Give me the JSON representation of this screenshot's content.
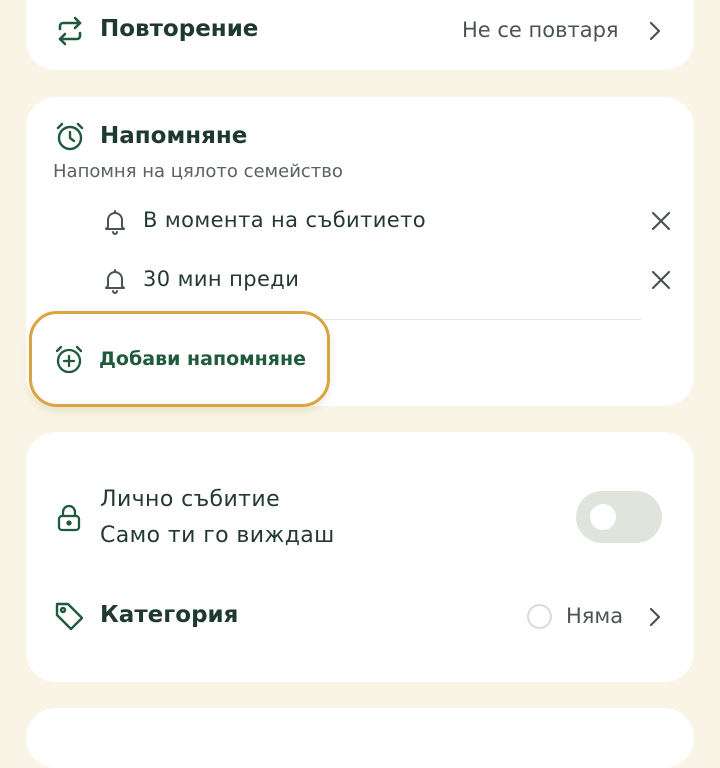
{
  "repeat": {
    "label": "Повторение",
    "value": "Не се повтаря",
    "icon": "repeat-icon"
  },
  "reminder": {
    "title": "Напомняне",
    "subtitle": "Напомня на цялото семейство",
    "icon": "alarm-clock-icon",
    "items": [
      {
        "label": "В момента на събитието",
        "icon": "bell-icon"
      },
      {
        "label": "30 мин преди",
        "icon": "bell-icon"
      }
    ],
    "add_label": "Добави напомняне"
  },
  "private_event": {
    "title": "Лично събитие",
    "subtitle": "Само ти го виждаш",
    "icon": "lock-icon",
    "enabled": false
  },
  "category": {
    "label": "Категория",
    "value": "Няма",
    "icon": "tag-icon"
  },
  "colors": {
    "background": "#f9f4e5",
    "card": "#ffffff",
    "accent_green": "#1f5a3c",
    "highlight": "#d9a441"
  }
}
